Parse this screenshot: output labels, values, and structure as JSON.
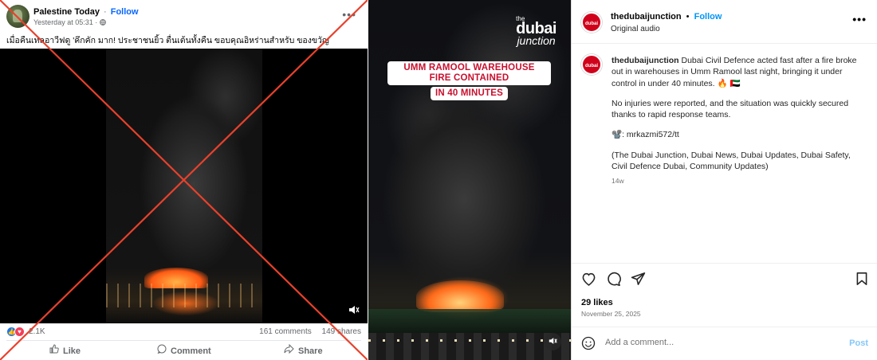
{
  "facebook": {
    "page_name": "Palestine Today",
    "separator": "·",
    "follow_label": "Follow",
    "timestamp": "Yesterday at 05:31 ·",
    "caption": "เมื่อคืนเทลอาวีฟดู 'คึกคัก มาก! ประชาชนยิ้ว ตื่นเต้นทั้งคืน  ขอบคุณอิหร่านสำหรับ ของขวัญ",
    "reaction_count": "2.1K",
    "comments": "161 comments",
    "shares": "149 shares",
    "actions": {
      "like": "Like",
      "comment": "Comment",
      "share": "Share"
    },
    "cross_color": "#e8412c"
  },
  "instagram_video": {
    "logo": {
      "the": "the",
      "dubai": "dubai",
      "junction": "junction"
    },
    "headline_line1": "UMM RAMOOL WAREHOUSE FIRE CONTAINED",
    "headline_line2": "IN 40 MINUTES",
    "headline_color": "#c8102e"
  },
  "instagram": {
    "avatar_text": "dubai",
    "username": "thedubaijunction",
    "separator": "•",
    "follow_label": "Follow",
    "audio": "Original audio",
    "caption_user": "thedubaijunction",
    "caption_p1": "Dubai Civil Defence acted fast after a fire broke out in warehouses in Umm Ramool last night, bringing it under control in under 40 minutes. 🔥 🇦🇪",
    "caption_p2": "No injuries were reported, and the situation was quickly secured thanks to rapid response teams.",
    "caption_p3": "📽️: mrkazmi572/tt",
    "caption_p4": "(The Dubai Junction, Dubai News, Dubai Updates, Dubai Safety, Civil Defence Dubai, Community Updates)",
    "age": "14w",
    "likes": "29 likes",
    "date": "November 25, 2025",
    "comment_placeholder": "Add a comment...",
    "post_label": "Post",
    "accent": "#0095f6"
  }
}
